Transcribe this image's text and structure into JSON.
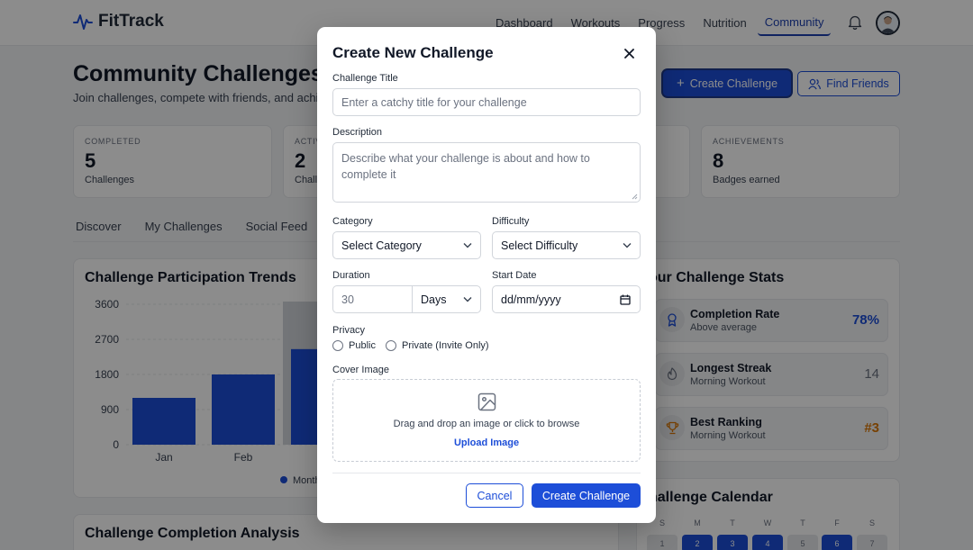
{
  "app": {
    "name": "FitTrack"
  },
  "nav": {
    "links": [
      "Dashboard",
      "Workouts",
      "Progress",
      "Nutrition",
      "Community"
    ],
    "active": "Community"
  },
  "header": {
    "title": "Community Challenges",
    "subtitle": "Join challenges, compete with friends, and achie",
    "create_label": "Create Challenge",
    "find_friends_label": "Find Friends"
  },
  "stats": [
    {
      "label": "COMPLETED",
      "value": "5",
      "sub": "Challenges"
    },
    {
      "label": "ACTIV",
      "value": "2",
      "sub": "Challe"
    },
    {
      "label": "ACHIEVEMENTS",
      "value": "8",
      "sub": "Badges earned"
    }
  ],
  "tabs": [
    "Discover",
    "My Challenges",
    "Social Feed"
  ],
  "participation_panel": {
    "title": "Challenge Participation Trends",
    "legend": "Month"
  },
  "chart_data": {
    "type": "bar",
    "title": "Challenge Participation Trends",
    "categories": [
      "Jan",
      "Feb",
      "M"
    ],
    "series": [
      {
        "name": "Month",
        "values": [
          1200,
          1800,
          2450
        ]
      }
    ],
    "y_ticks": [
      "3600",
      "2700",
      "1800",
      "900",
      "0"
    ],
    "ylim": [
      0,
      3600
    ],
    "bar_color": "#1d4ed8",
    "grid": true
  },
  "completion_panel": {
    "title": "Challenge Completion Analysis"
  },
  "stats_panel": {
    "title": "our Challenge Stats",
    "rows": [
      {
        "title": "Completion Rate",
        "sub": "Above average",
        "value": "78%",
        "color": "#1d4ed8",
        "icon": "award-icon"
      },
      {
        "title": "Longest Streak",
        "sub": "Morning Workout",
        "value": "14",
        "color": "#6b7280",
        "icon": "flame-icon"
      },
      {
        "title": "Best Ranking",
        "sub": "Morning Workout",
        "value": "#3",
        "color": "#d97706",
        "icon": "trophy-icon"
      }
    ]
  },
  "calendar": {
    "title": "hallenge Calendar",
    "weekdays": [
      "S",
      "M",
      "T",
      "W",
      "T",
      "F",
      "S"
    ],
    "days": [
      {
        "n": "1",
        "active": false
      },
      {
        "n": "2",
        "active": true
      },
      {
        "n": "3",
        "active": true
      },
      {
        "n": "4",
        "active": true
      },
      {
        "n": "5",
        "active": false
      },
      {
        "n": "6",
        "active": true
      },
      {
        "n": "7",
        "active": false
      }
    ]
  },
  "modal": {
    "title": "Create New Challenge",
    "title_label": "Challenge Title",
    "title_placeholder": "Enter a catchy title for your challenge",
    "description_label": "Description",
    "description_placeholder": "Describe what your challenge is about and how to complete it",
    "category_label": "Category",
    "category_value": "Select Category",
    "difficulty_label": "Difficulty",
    "difficulty_value": "Select Difficulty",
    "duration_label": "Duration",
    "duration_placeholder": "30",
    "duration_unit": "Days",
    "start_date_label": "Start Date",
    "start_date_placeholder": "dd/mm/yyyy",
    "privacy_label": "Privacy",
    "privacy_options": [
      "Public",
      "Private (Invite Only)"
    ],
    "cover_label": "Cover Image",
    "cover_text": "Drag and drop an image or click to browse",
    "cover_link": "Upload Image",
    "cancel_label": "Cancel",
    "create_label": "Create Challenge"
  }
}
